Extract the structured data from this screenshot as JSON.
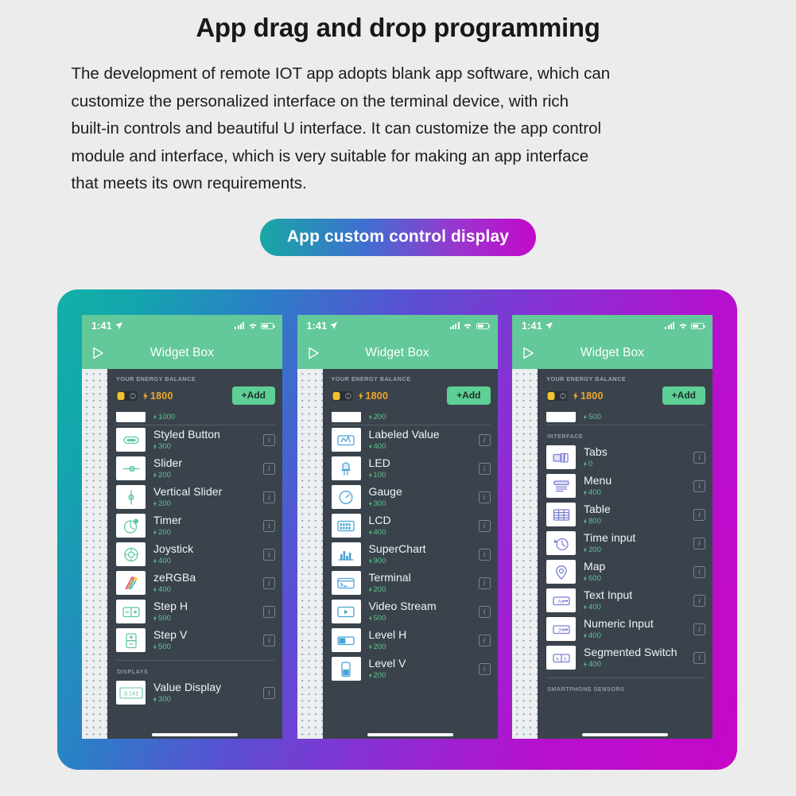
{
  "header": {
    "title": "App drag and drop programming",
    "paragraph_lines": [
      "The development of remote IOT app adopts blank app software, which can",
      "customize the personalized interface on the terminal device, with rich",
      "built-in controls and beautiful U interface. It can customize the app control",
      "module and interface, which is very suitable for making an app interface",
      "that meets its own requirements."
    ]
  },
  "cta": {
    "label": "App custom control display"
  },
  "colors": {
    "frame_gradient_start": "#12b0a6",
    "frame_gradient_end": "#c707c9",
    "appbar_green": "#63c89a",
    "drawer_dark": "#3a434c",
    "cost_green": "#5ec48f",
    "coin_orange": "#f0a828",
    "add_button": "#5ecf95"
  },
  "phones": [
    {
      "status": {
        "time": "1:41",
        "location_icon": "location-arrow-icon",
        "signal_icon": "signal-bars-icon",
        "wifi_icon": "wifi-icon",
        "battery_icon": "battery-icon"
      },
      "appbar": {
        "play_icon": "play-triangle-icon",
        "title": "Widget Box"
      },
      "energy": {
        "caption": "YOUR ENERGY BALANCE",
        "battery_icon": "energy-battery-icon",
        "amount": "1800",
        "add_label": "+Add"
      },
      "partial_top": {
        "cost": "1000"
      },
      "sections": [
        {
          "caption": "",
          "items": [
            {
              "name": "Styled Button",
              "cost": "300",
              "icon": "styled-button-icon"
            },
            {
              "name": "Slider",
              "cost": "200",
              "icon": "slider-icon"
            },
            {
              "name": "Vertical Slider",
              "cost": "200",
              "icon": "vertical-slider-icon"
            },
            {
              "name": "Timer",
              "cost": "200",
              "icon": "timer-icon"
            },
            {
              "name": "Joystick",
              "cost": "400",
              "icon": "joystick-icon"
            },
            {
              "name": "zeRGBa",
              "cost": "400",
              "icon": "zergba-icon"
            },
            {
              "name": "Step H",
              "cost": "500",
              "icon": "step-horizontal-icon"
            },
            {
              "name": "Step V",
              "cost": "500",
              "icon": "step-vertical-icon"
            }
          ]
        },
        {
          "caption": "DISPLAYS",
          "items": [
            {
              "name": "Value Display",
              "cost": "300",
              "icon": "value-display-icon"
            }
          ]
        }
      ]
    },
    {
      "status": {
        "time": "1:41",
        "location_icon": "location-arrow-icon",
        "signal_icon": "signal-bars-icon",
        "wifi_icon": "wifi-icon",
        "battery_icon": "battery-icon"
      },
      "appbar": {
        "play_icon": "play-triangle-icon",
        "title": "Widget Box"
      },
      "energy": {
        "caption": "YOUR ENERGY BALANCE",
        "battery_icon": "energy-battery-icon",
        "amount": "1800",
        "add_label": "+Add"
      },
      "partial_top": {
        "cost": "200"
      },
      "sections": [
        {
          "caption": "",
          "items": [
            {
              "name": "Labeled Value",
              "cost": "400",
              "icon": "labeled-value-icon"
            },
            {
              "name": "LED",
              "cost": "100",
              "icon": "led-icon"
            },
            {
              "name": "Gauge",
              "cost": "300",
              "icon": "gauge-icon"
            },
            {
              "name": "LCD",
              "cost": "400",
              "icon": "lcd-icon"
            },
            {
              "name": "SuperChart",
              "cost": "900",
              "icon": "superchart-icon"
            },
            {
              "name": "Terminal",
              "cost": "200",
              "icon": "terminal-icon"
            },
            {
              "name": "Video Stream",
              "cost": "500",
              "icon": "video-stream-icon"
            },
            {
              "name": "Level H",
              "cost": "200",
              "icon": "level-horizontal-icon"
            },
            {
              "name": "Level V",
              "cost": "200",
              "icon": "level-vertical-icon"
            }
          ]
        }
      ]
    },
    {
      "status": {
        "time": "1:41",
        "location_icon": "location-arrow-icon",
        "signal_icon": "signal-bars-icon",
        "wifi_icon": "wifi-icon",
        "battery_icon": "battery-icon"
      },
      "appbar": {
        "play_icon": "play-triangle-icon",
        "title": "Widget Box"
      },
      "energy": {
        "caption": "YOUR ENERGY BALANCE",
        "battery_icon": "energy-battery-icon",
        "amount": "1800",
        "add_label": "+Add"
      },
      "partial_top": {
        "cost": "500"
      },
      "sections": [
        {
          "caption": "INTERFACE",
          "items": [
            {
              "name": "Tabs",
              "cost": "0",
              "icon": "tabs-icon"
            },
            {
              "name": "Menu",
              "cost": "400",
              "icon": "menu-icon"
            },
            {
              "name": "Table",
              "cost": "800",
              "icon": "table-icon"
            },
            {
              "name": "Time input",
              "cost": "200",
              "icon": "time-input-icon"
            },
            {
              "name": "Map",
              "cost": "600",
              "icon": "map-pin-icon"
            },
            {
              "name": "Text Input",
              "cost": "400",
              "icon": "text-input-icon"
            },
            {
              "name": "Numeric Input",
              "cost": "400",
              "icon": "numeric-input-icon"
            },
            {
              "name": "Segmented Switch",
              "cost": "400",
              "icon": "segmented-switch-icon"
            }
          ]
        },
        {
          "caption": "SMARTPHONE SENSORS",
          "items": []
        }
      ]
    }
  ]
}
